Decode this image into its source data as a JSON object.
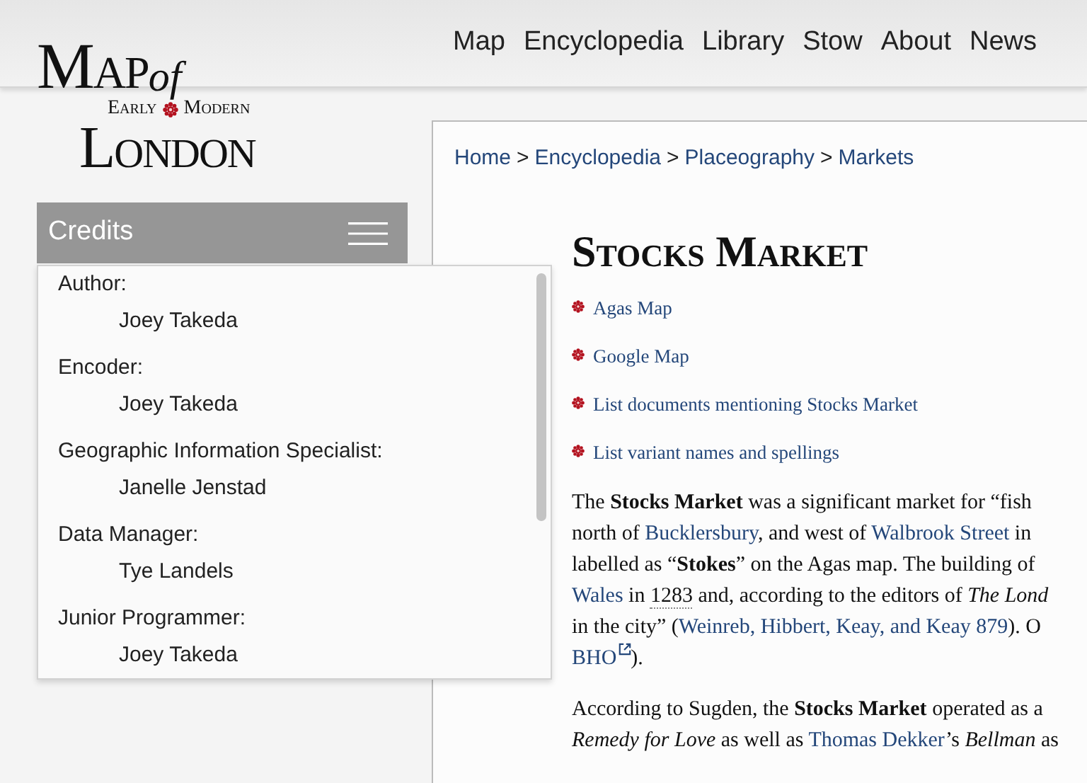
{
  "logo": {
    "map": "Map",
    "of": "of",
    "early": "Early",
    "modern": "Modern",
    "london": "London"
  },
  "nav": [
    "Map",
    "Encyclopedia",
    "Library",
    "Stow",
    "About",
    "News"
  ],
  "credits": {
    "title": "Credits",
    "entries": [
      {
        "role": "Author:",
        "name": "Joey Takeda"
      },
      {
        "role": "Encoder:",
        "name": "Joey Takeda"
      },
      {
        "role": "Geographic Information Specialist:",
        "name": "Janelle Jenstad"
      },
      {
        "role": "Data Manager:",
        "name": "Tye Landels"
      },
      {
        "role": "Junior Programmer:",
        "name": "Joey Takeda"
      }
    ]
  },
  "breadcrumb": {
    "separator": ">",
    "items": [
      "Home",
      "Encyclopedia",
      "Placeography",
      "Markets"
    ]
  },
  "title": "Stocks Market",
  "links": [
    "Agas Map",
    "Google Map",
    "List documents mentioning Stocks Market",
    "List variant names and spellings"
  ],
  "paragraphs": [
    [
      [
        {
          "kind": "plain",
          "text": "The "
        },
        {
          "kind": "bold",
          "text": "Stocks Market"
        },
        {
          "kind": "plain",
          "text": " was a significant market for “fish"
        }
      ],
      [
        {
          "kind": "plain",
          "text": "north of "
        },
        {
          "kind": "link",
          "text": "Bucklersbury"
        },
        {
          "kind": "plain",
          "text": ", and west of "
        },
        {
          "kind": "link",
          "text": "Walbrook Street"
        },
        {
          "kind": "plain",
          "text": " in"
        }
      ],
      [
        {
          "kind": "plain",
          "text": "labelled as “"
        },
        {
          "kind": "bold",
          "text": "Stokes"
        },
        {
          "kind": "plain",
          "text": "” on the Agas map. The building of"
        }
      ],
      [
        {
          "kind": "link",
          "text": "Wales"
        },
        {
          "kind": "plain",
          "text": " in "
        },
        {
          "kind": "date",
          "text": "1283"
        },
        {
          "kind": "plain",
          "text": " and, according to the editors of "
        },
        {
          "kind": "italic",
          "text": "The Lond"
        }
      ],
      [
        {
          "kind": "plain",
          "text": "in the city” ("
        },
        {
          "kind": "link",
          "text": "Weinreb, Hibbert, Keay, and Keay 879"
        },
        {
          "kind": "plain",
          "text": "). O"
        }
      ],
      [
        {
          "kind": "external",
          "text": "BHO"
        },
        {
          "kind": "plain",
          "text": ")."
        }
      ]
    ],
    [
      [
        {
          "kind": "plain",
          "text": "According to Sugden, the "
        },
        {
          "kind": "bold",
          "text": "Stocks Market"
        },
        {
          "kind": "plain",
          "text": " operated as a"
        }
      ],
      [
        {
          "kind": "italic",
          "text": "Remedy for Love"
        },
        {
          "kind": "plain",
          "text": " as well as "
        },
        {
          "kind": "link",
          "text": "Thomas Dekker"
        },
        {
          "kind": "plain",
          "text": "’s "
        },
        {
          "kind": "italic",
          "text": "Bellman"
        },
        {
          "kind": "plain",
          "text": " as"
        }
      ]
    ]
  ]
}
